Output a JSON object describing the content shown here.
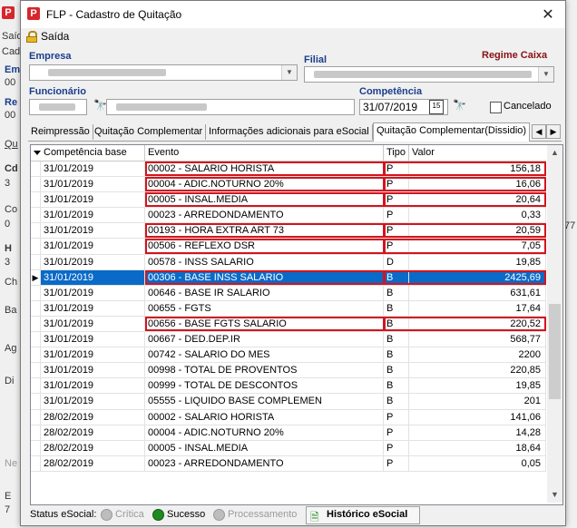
{
  "window": {
    "title": "FLP - Cadastro de Quitação",
    "app_icon": "P"
  },
  "menu": {
    "saida": "Saída"
  },
  "form": {
    "empresa_label": "Empresa",
    "filial_label": "Filial",
    "regime": "Regime Caixa",
    "funcionario_label": "Funcionário",
    "competencia_label": "Competência",
    "competencia_value": "31/07/2019",
    "cancelado_label": "Cancelado"
  },
  "tabs": [
    {
      "label": "Reimpressão"
    },
    {
      "label": "Quitação Complementar"
    },
    {
      "label": "Informações adicionais para eSocial"
    },
    {
      "label": "Quitação Complementar(Dissidio)"
    }
  ],
  "grid": {
    "headers": {
      "competencia": "Competência base",
      "evento": "Evento",
      "tipo": "Tipo",
      "valor": "Valor"
    },
    "rows": [
      {
        "comp": "31/01/2019",
        "evento": "00002 - SALARIO HORISTA",
        "tipo": "P",
        "valor": "156,18",
        "highlight": true
      },
      {
        "comp": "31/01/2019",
        "evento": "00004 - ADIC.NOTURNO  20%",
        "tipo": "P",
        "valor": "16,06",
        "highlight": true
      },
      {
        "comp": "31/01/2019",
        "evento": "00005 - INSAL.MEDIA",
        "tipo": "P",
        "valor": "20,64",
        "highlight": true
      },
      {
        "comp": "31/01/2019",
        "evento": "00023 - ARREDONDAMENTO",
        "tipo": "P",
        "valor": "0,33"
      },
      {
        "comp": "31/01/2019",
        "evento": "00193 - HORA EXTRA ART 73",
        "tipo": "P",
        "valor": "20,59",
        "highlight": true
      },
      {
        "comp": "31/01/2019",
        "evento": "00506 - REFLEXO DSR",
        "tipo": "P",
        "valor": "7,05",
        "highlight": true
      },
      {
        "comp": "31/01/2019",
        "evento": "00578 - INSS SALARIO",
        "tipo": "D",
        "valor": "19,85"
      },
      {
        "comp": "31/01/2019",
        "evento": "00306 - BASE INSS SALARIO",
        "tipo": "B",
        "valor": "2425,69",
        "selected": true,
        "highlight": true
      },
      {
        "comp": "31/01/2019",
        "evento": "00646 - BASE IR SALARIO",
        "tipo": "B",
        "valor": "631,61"
      },
      {
        "comp": "31/01/2019",
        "evento": "00655 - FGTS",
        "tipo": "B",
        "valor": "17,64"
      },
      {
        "comp": "31/01/2019",
        "evento": "00656 - BASE FGTS SALARIO",
        "tipo": "B",
        "valor": "220,52",
        "highlight": true
      },
      {
        "comp": "31/01/2019",
        "evento": "00667 - DED.DEP.IR",
        "tipo": "B",
        "valor": "568,77"
      },
      {
        "comp": "31/01/2019",
        "evento": "00742 - SALARIO DO MES",
        "tipo": "B",
        "valor": "2200"
      },
      {
        "comp": "31/01/2019",
        "evento": "00998 - TOTAL DE PROVENTOS",
        "tipo": "B",
        "valor": "220,85"
      },
      {
        "comp": "31/01/2019",
        "evento": "00999 - TOTAL DE DESCONTOS",
        "tipo": "B",
        "valor": "19,85"
      },
      {
        "comp": "31/01/2019",
        "evento": "05555 - LIQUIDO BASE COMPLEMEN",
        "tipo": "B",
        "valor": "201"
      },
      {
        "comp": "28/02/2019",
        "evento": "00002 - SALARIO HORISTA",
        "tipo": "P",
        "valor": "141,06"
      },
      {
        "comp": "28/02/2019",
        "evento": "00004 - ADIC.NOTURNO  20%",
        "tipo": "P",
        "valor": "14,28"
      },
      {
        "comp": "28/02/2019",
        "evento": "00005 - INSAL.MEDIA",
        "tipo": "P",
        "valor": "18,64"
      },
      {
        "comp": "28/02/2019",
        "evento": "00023 - ARREDONDAMENTO",
        "tipo": "P",
        "valor": "0,05"
      }
    ]
  },
  "status": {
    "label": "Status eSocial:",
    "critica": "Crítica",
    "sucesso": "Sucesso",
    "processamento": "Processamento",
    "historico": "Histórico eSocial"
  },
  "colors": {
    "highlight": "#d4141e",
    "selection": "#0a6ac8",
    "label_blue": "#1a3d8c",
    "label_red": "#8a1014",
    "success": "#1f8a1f"
  },
  "background_fragments": [
    "Saíd",
    "Cad",
    "Em",
    "00",
    "Re",
    "00",
    "Qu",
    "Cd",
    "3",
    "Co",
    "0",
    "H",
    "3",
    "Ch",
    "Ba",
    "Ag",
    "Di",
    "77",
    "Ne",
    "E",
    "7"
  ]
}
